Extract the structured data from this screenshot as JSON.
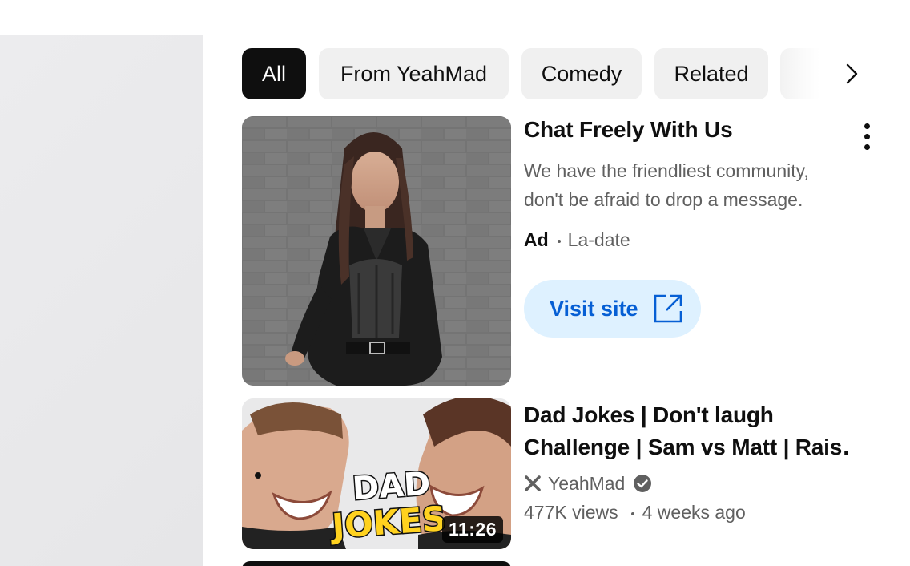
{
  "chips": {
    "items": [
      {
        "label": "All",
        "active": true
      },
      {
        "label": "From YeahMad",
        "active": false
      },
      {
        "label": "Comedy",
        "active": false
      },
      {
        "label": "Related",
        "active": false
      }
    ],
    "next_icon": "chevron-right-icon"
  },
  "ad": {
    "title": "Chat Freely With Us",
    "description": "We have the friendliest community, don't be afraid to drop a message.",
    "badge": "Ad",
    "advertiser": "La-date",
    "cta_label": "Visit site",
    "cta_icon": "external-link-icon",
    "more_icon": "more-vert-icon"
  },
  "video": {
    "title_line1": "Dad Jokes | Don't laugh",
    "title_line2": "Challenge | Sam vs Matt | Rais",
    "thumbnail_text_top": "DAD",
    "thumbnail_text_bottom": "JOKES",
    "duration": "11:26",
    "channel": "YeahMad",
    "channel_icon": "x-icon",
    "verified_icon": "verified-check-icon",
    "views": "477K views",
    "age": "4 weeks ago"
  },
  "colors": {
    "chip_active_bg": "#0f0f0f",
    "chip_bg": "#f0f0f0",
    "cta_bg": "#def1ff",
    "cta_text": "#065fd4",
    "secondary_text": "#606060"
  }
}
